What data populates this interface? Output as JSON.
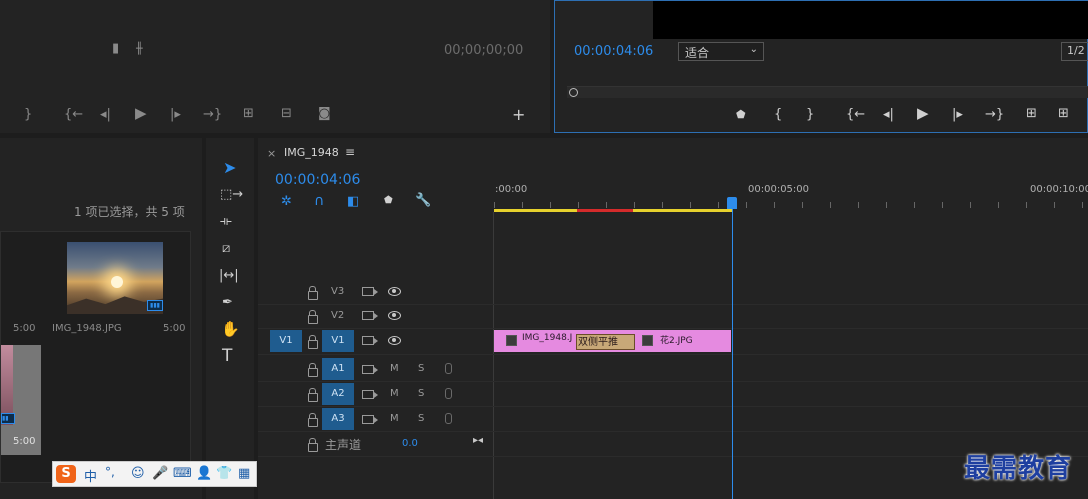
{
  "source_monitor": {
    "timecode": "00;00;00;00"
  },
  "program_monitor": {
    "timecode": "00:00:04:06",
    "fit_select": "适合",
    "resolution": "1/2"
  },
  "project_panel": {
    "selection_status": "1 项已选择，共 5 项",
    "items": [
      {
        "name": "IMG_1948.JPG",
        "duration": "5:00"
      },
      {
        "name": "",
        "duration": "5:00"
      },
      {
        "name": "",
        "duration": "5:00"
      }
    ]
  },
  "sequence": {
    "tab_title": "IMG_1948",
    "tab_close": "×",
    "tab_menu": "≡",
    "timecode": "00:00:04:06",
    "ruler_labels": [
      ":00:00",
      "00:00:05:00",
      "00:00:10:00"
    ],
    "tracks_video": [
      {
        "label": "V3",
        "source": ""
      },
      {
        "label": "V2",
        "source": ""
      },
      {
        "label": "V1",
        "source": "V1"
      }
    ],
    "tracks_audio": [
      {
        "label": "A1",
        "m": "M",
        "s": "S"
      },
      {
        "label": "A2",
        "m": "M",
        "s": "S"
      },
      {
        "label": "A3",
        "m": "M",
        "s": "S"
      }
    ],
    "master": {
      "label": "主声道",
      "value": "0.0"
    },
    "clips": [
      {
        "name": "IMG_1948.J"
      },
      {
        "name": "花2.JPG"
      }
    ],
    "transition": {
      "name": "双侧平推"
    }
  },
  "ime_toolbar": {
    "lang": "中",
    "punct": "°,"
  },
  "watermark": {
    "text": "最需教育"
  },
  "colors": {
    "accent": "#2d8ceb",
    "clip": "#e58ae0",
    "playhead": "#2d8ceb"
  }
}
